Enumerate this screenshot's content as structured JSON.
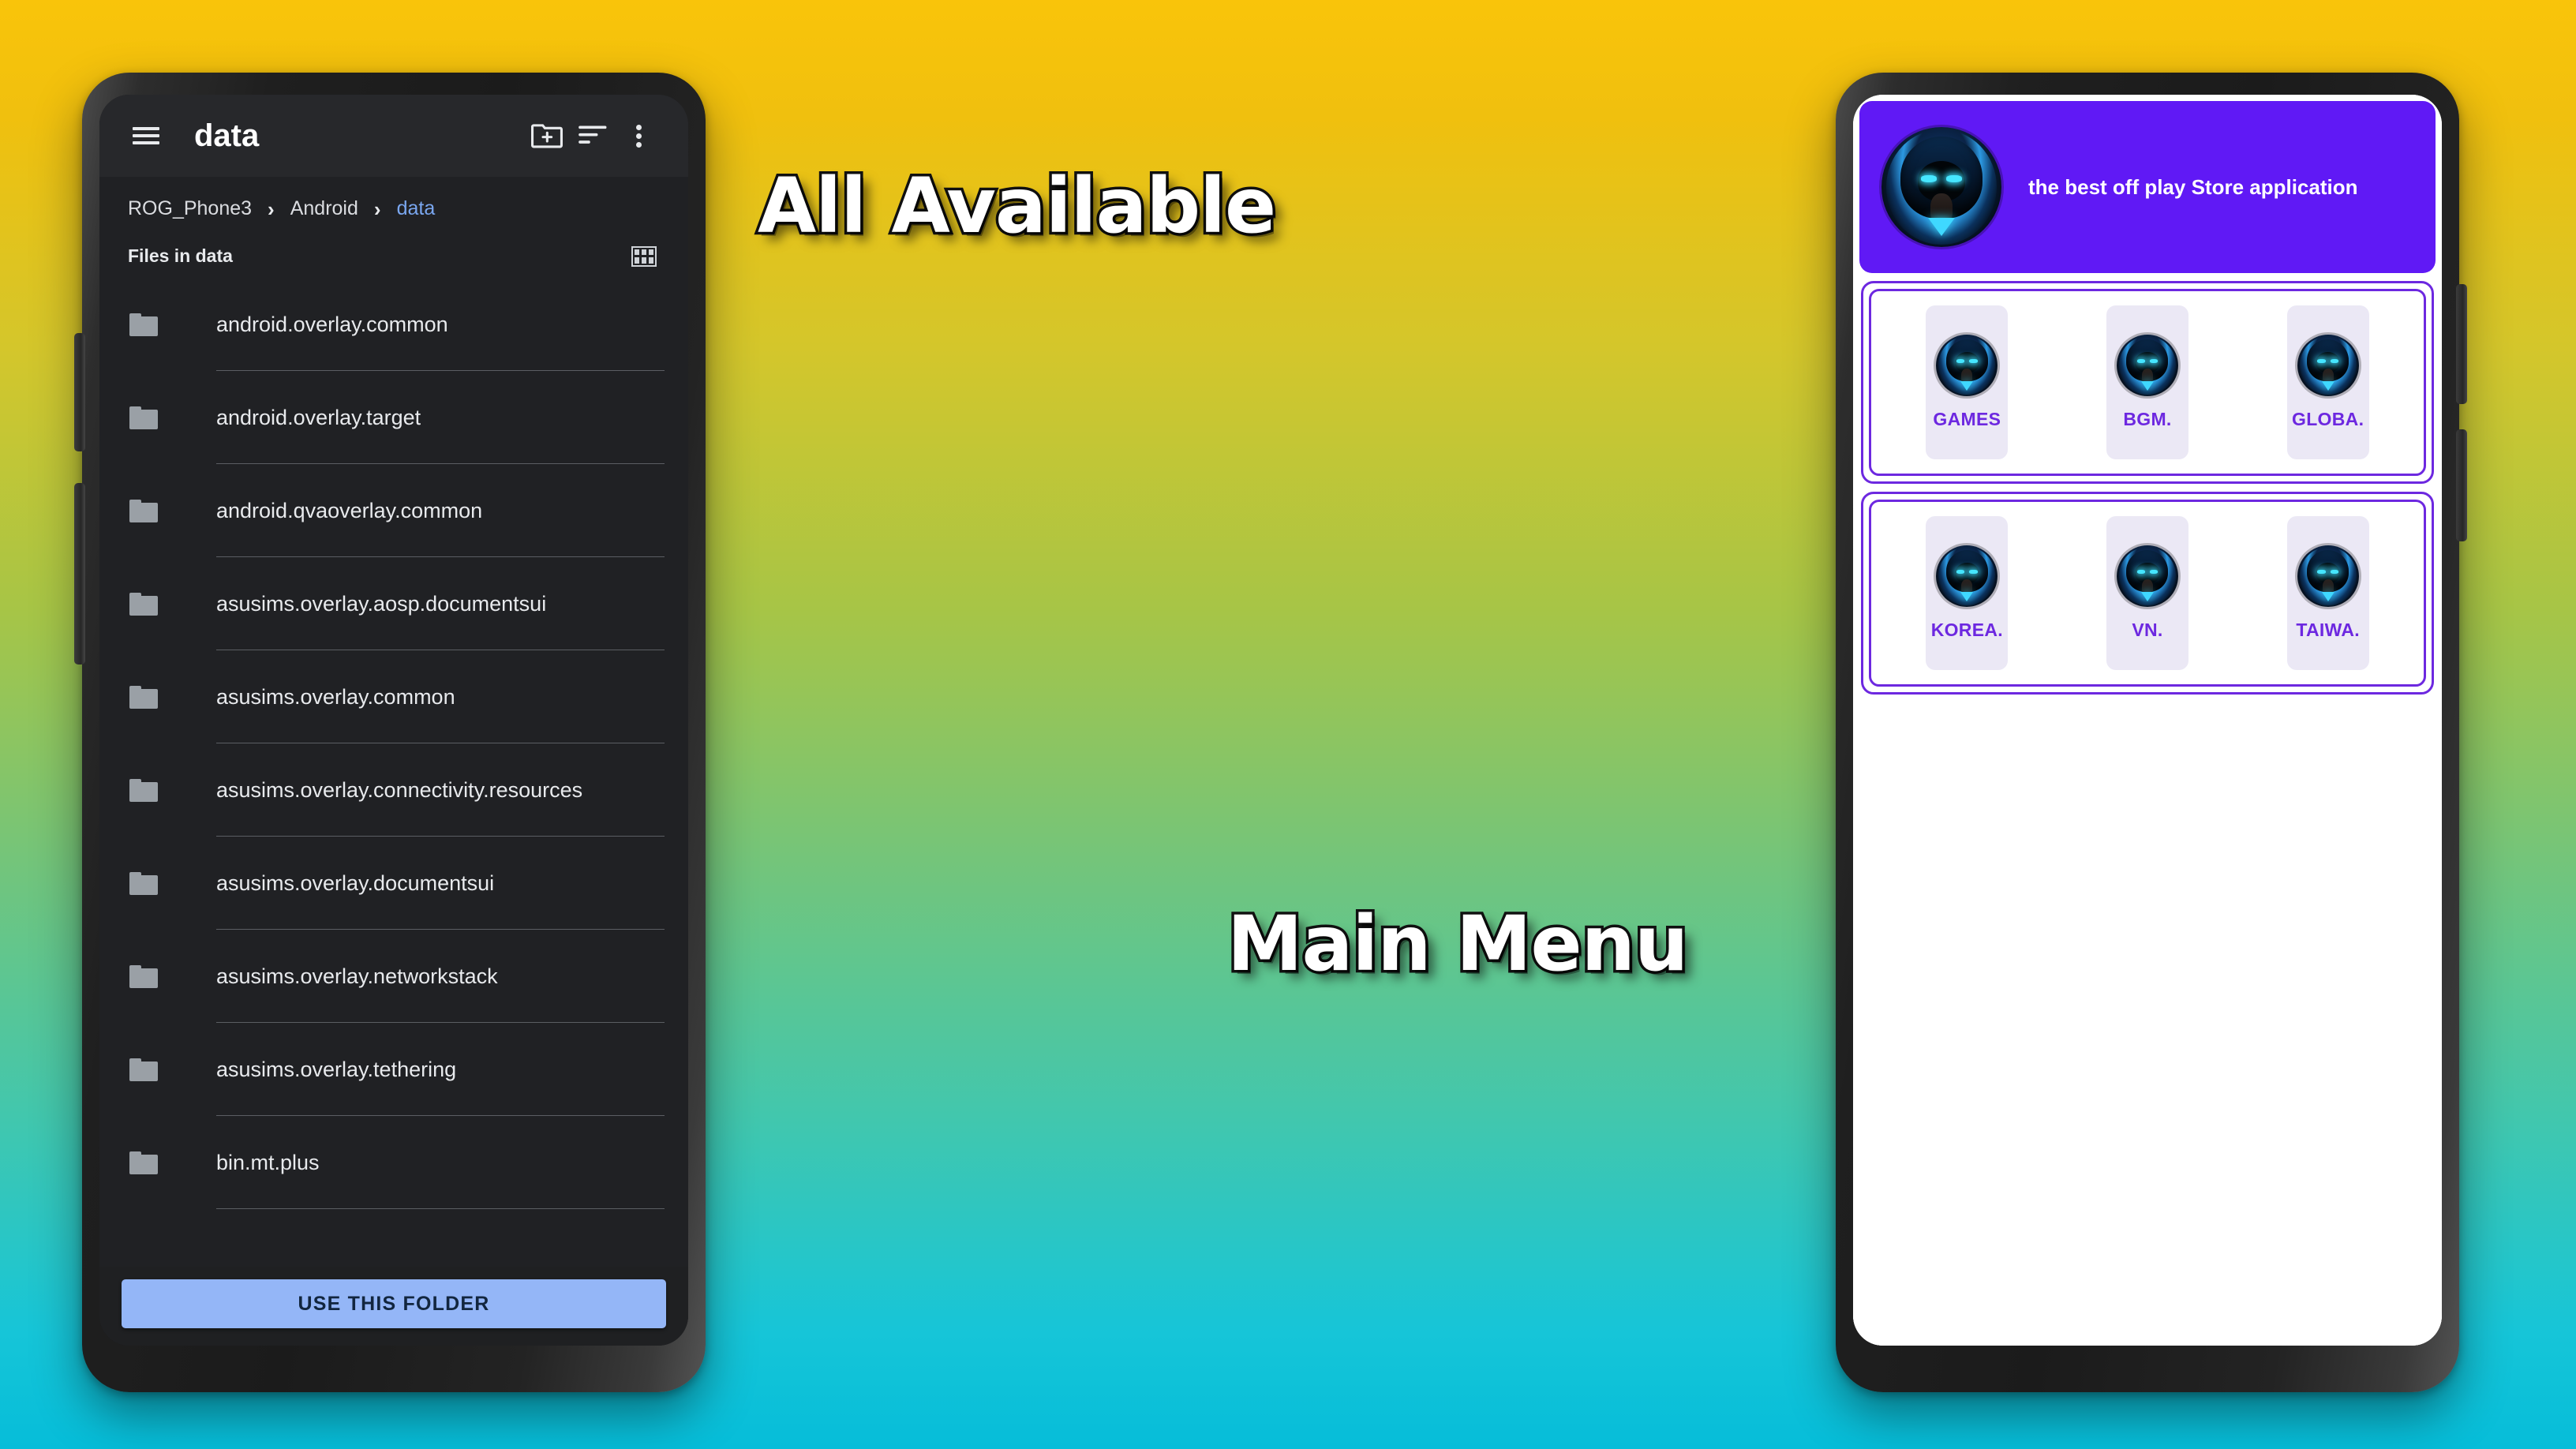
{
  "background": {
    "gradient_top": "#F9C40A",
    "gradient_mid": "#8CC14F",
    "gradient_bottom": "#06BDD9"
  },
  "overlay": {
    "headline_top": "All Available",
    "headline_bottom": "Main Menu"
  },
  "file_manager": {
    "appbar": {
      "menu_icon": "hamburger-icon",
      "title": "data",
      "new_folder_icon": "new-folder-icon",
      "sort_icon": "sort-icon",
      "overflow_icon": "more-vertical-icon"
    },
    "breadcrumb": {
      "items": [
        "ROG_Phone3",
        "Android",
        "data"
      ],
      "separator": "›",
      "current_index": 2,
      "current_color": "#7aa7f0"
    },
    "subheader": {
      "label": "Files in data",
      "view_toggle_icon": "grid-view-icon"
    },
    "files": [
      {
        "name": "android.overlay.common",
        "icon": "folder-icon"
      },
      {
        "name": "android.overlay.target",
        "icon": "folder-icon"
      },
      {
        "name": "android.qvaoverlay.common",
        "icon": "folder-icon"
      },
      {
        "name": "asusims.overlay.aosp.documentsui",
        "icon": "folder-icon"
      },
      {
        "name": "asusims.overlay.common",
        "icon": "folder-icon"
      },
      {
        "name": "asusims.overlay.connectivity.resources",
        "icon": "folder-icon"
      },
      {
        "name": "asusims.overlay.documentsui",
        "icon": "folder-icon"
      },
      {
        "name": "asusims.overlay.networkstack",
        "icon": "folder-icon"
      },
      {
        "name": "asusims.overlay.tethering",
        "icon": "folder-icon"
      },
      {
        "name": "bin.mt.plus",
        "icon": "folder-icon"
      }
    ],
    "footer": {
      "primary_button": "USE THIS FOLDER",
      "primary_button_color": "#94b6f7"
    }
  },
  "app_store": {
    "banner": {
      "title": "the best off play Store application",
      "background_color": "#6019F5",
      "logo_icon": "hooded-figure-app-logo"
    },
    "accent_color": "#6D28E0",
    "card_background": "#EBE8F5",
    "rows": [
      {
        "cards": [
          {
            "label": "GAMES",
            "icon": "hooded-figure-app-logo"
          },
          {
            "label": "BGM.",
            "icon": "hooded-figure-app-logo"
          },
          {
            "label": "GLOBA.",
            "icon": "hooded-figure-app-logo"
          }
        ]
      },
      {
        "cards": [
          {
            "label": "KOREA.",
            "icon": "hooded-figure-app-logo"
          },
          {
            "label": "VN.",
            "icon": "hooded-figure-app-logo"
          },
          {
            "label": "TAIWA.",
            "icon": "hooded-figure-app-logo"
          }
        ]
      }
    ]
  }
}
